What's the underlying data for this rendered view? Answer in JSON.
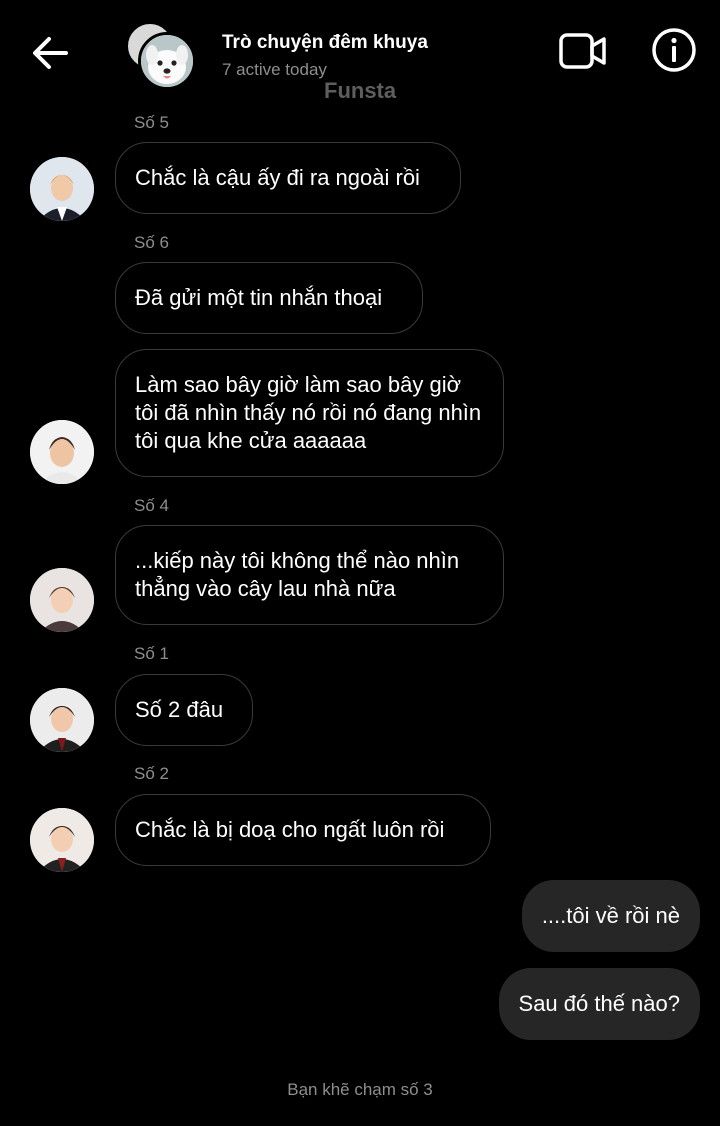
{
  "header": {
    "title": "Trò chuyện đêm khuya",
    "subtitle": "7 active today",
    "watermark": "Funsta",
    "back_icon": "arrow-left-icon",
    "video_icon": "video-camera-icon",
    "info_icon": "info-icon"
  },
  "messages": [
    {
      "sender": "Số 5",
      "text": "Chắc là cậu ấy đi ra ngoài rồi"
    },
    {
      "sender": "Số 6",
      "text": "Đã gửi một tin nhắn thoại"
    },
    {
      "sender": "",
      "text": "Làm sao bây giờ làm sao bây giờ tôi đã nhìn thấy nó rồi nó đang nhìn tôi qua khe cửa aaaaaa"
    },
    {
      "sender": "Số 4",
      "text": "...kiếp này tôi không thể nào nhìn thẳng vào cây lau nhà nữa"
    },
    {
      "sender": "Số 1",
      "text": "Số 2 đâu"
    },
    {
      "sender": "Số 2",
      "text": "Chắc là bị doạ cho ngất luôn rồi"
    }
  ],
  "outgoing": [
    {
      "text": "....tôi về rồi nè"
    },
    {
      "text": "Sau đó thế nào?"
    }
  ],
  "footer": {
    "text": "Bạn khẽ chạm số 3"
  },
  "colors": {
    "background": "#000000",
    "outgoing_bubble": "#262626",
    "muted_text": "#8e8e8e"
  }
}
